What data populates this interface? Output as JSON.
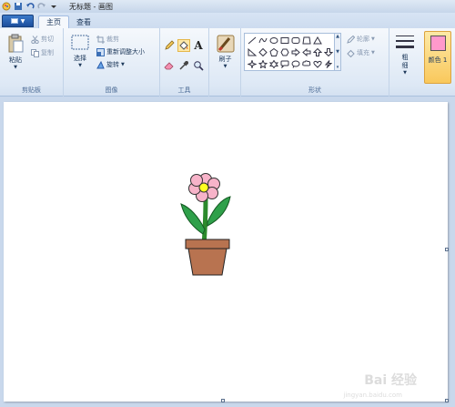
{
  "window": {
    "title": "无标题 - 画图"
  },
  "tabs": [
    {
      "label": "主页"
    },
    {
      "label": "查看"
    }
  ],
  "clipboard": {
    "paste_label": "粘贴",
    "cut_label": "剪切",
    "copy_label": "复制",
    "group_label": "剪贴板"
  },
  "image": {
    "select_label": "选择",
    "crop_label": "裁剪",
    "resize_label": "重新调整大小",
    "rotate_label": "旋转",
    "group_label": "图像"
  },
  "tools": {
    "group_label": "工具",
    "text_tool_glyph": "A"
  },
  "brushes": {
    "label": "刷子"
  },
  "shapes": {
    "outline_label": "轮廓",
    "fill_label": "填充",
    "group_label": "形状"
  },
  "size": {
    "label": "粗细"
  },
  "color": {
    "label": "颜色 1",
    "value": "#ff99cc"
  },
  "watermark": {
    "brand": "Bai 经验",
    "url": "jingyan.baidu.com"
  }
}
